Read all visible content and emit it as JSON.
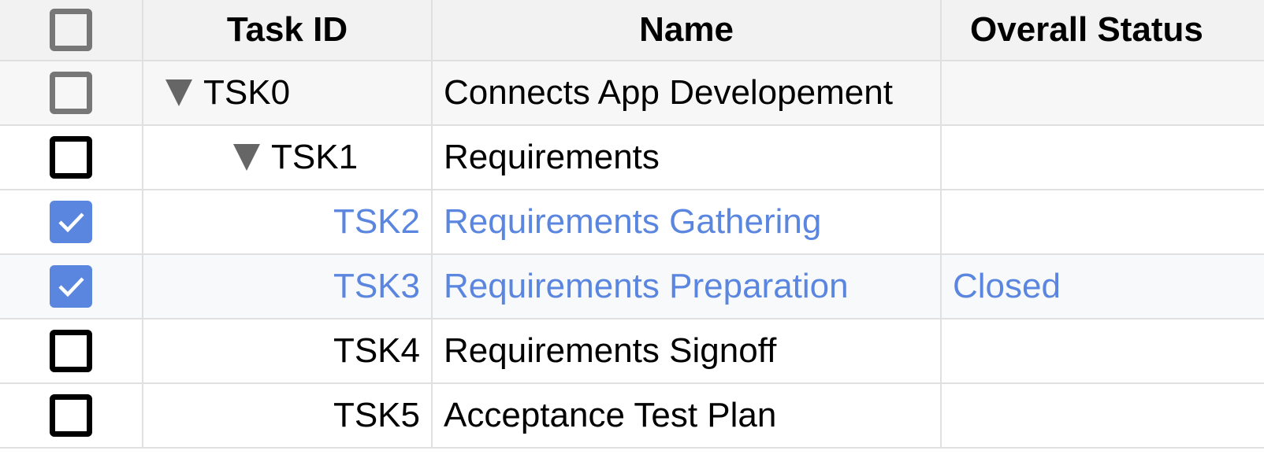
{
  "columns": [
    "",
    "Task ID",
    "Name",
    "Overall Status"
  ],
  "header_checkbox": {
    "checked": false,
    "state": "disabled"
  },
  "rows": [
    {
      "task_id": "TSK0",
      "name": "Connects App Developement",
      "status": "",
      "checked": false,
      "expandable": true,
      "expanded": true,
      "level": 0
    },
    {
      "task_id": "TSK1",
      "name": "Requirements",
      "status": "",
      "checked": false,
      "expandable": true,
      "expanded": true,
      "level": 1
    },
    {
      "task_id": "TSK2",
      "name": "Requirements Gathering",
      "status": "",
      "checked": true,
      "expandable": false,
      "level": 2
    },
    {
      "task_id": "TSK3",
      "name": "Requirements Preparation",
      "status": "Closed",
      "checked": true,
      "expandable": false,
      "level": 2
    },
    {
      "task_id": "TSK4",
      "name": "Requirements Signoff",
      "status": "",
      "checked": false,
      "expandable": false,
      "level": 2
    },
    {
      "task_id": "TSK5",
      "name": "Acceptance Test Plan",
      "status": "",
      "checked": false,
      "expandable": false,
      "level": 2
    }
  ],
  "colors": {
    "accent": "#5b86e0",
    "header_bg": "#f2f2f2",
    "grid_line": "#e0e0e0",
    "expander": "#666666"
  }
}
